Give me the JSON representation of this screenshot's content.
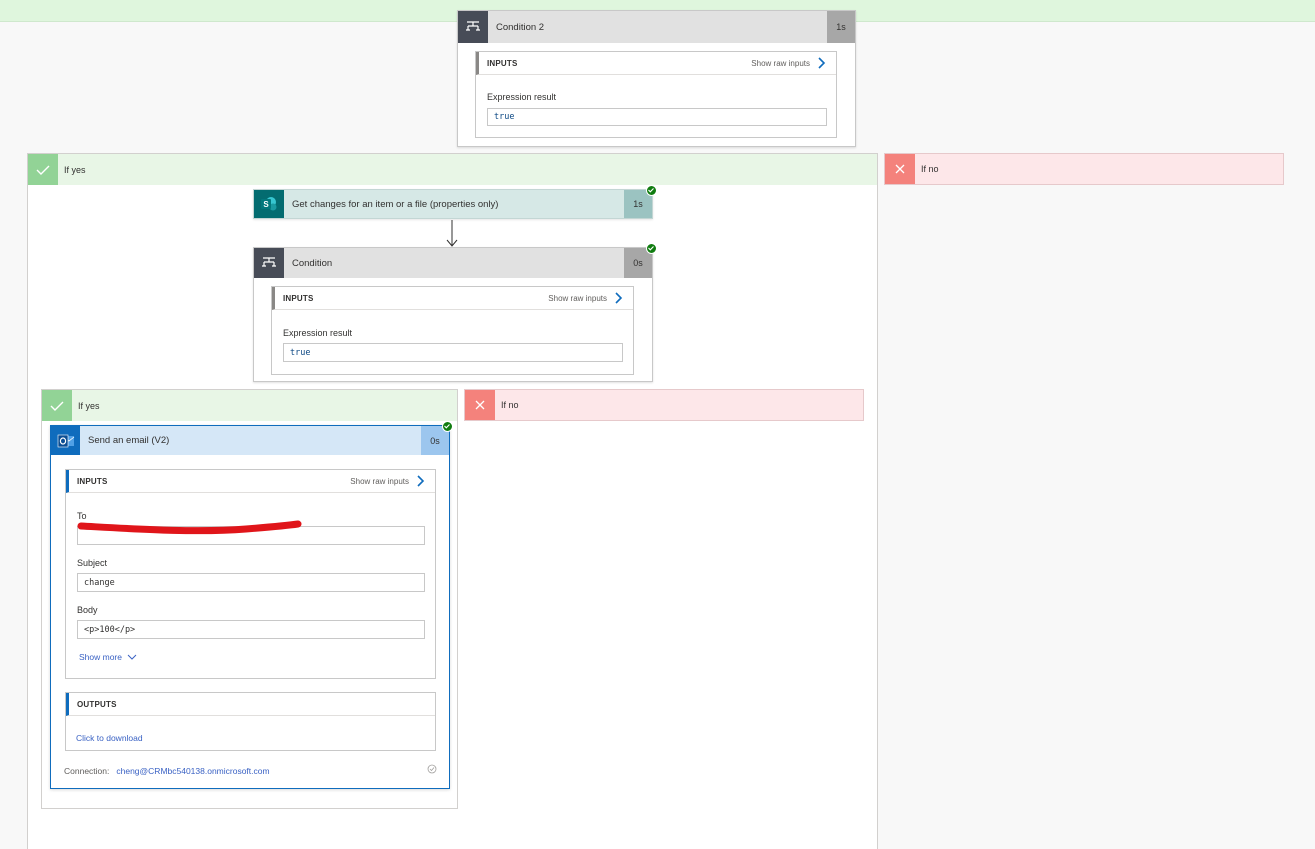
{
  "condition2": {
    "title": "Condition 2",
    "duration": "1s",
    "inputs_label": "INPUTS",
    "show_raw": "Show raw inputs",
    "expr_label": "Expression result",
    "expr_value": "true"
  },
  "branch_outer_yes": {
    "label": "If yes"
  },
  "branch_outer_no": {
    "label": "If no"
  },
  "get_changes": {
    "title": "Get changes for an item or a file (properties only)",
    "duration": "1s"
  },
  "condition": {
    "title": "Condition",
    "duration": "0s",
    "inputs_label": "INPUTS",
    "show_raw": "Show raw inputs",
    "expr_label": "Expression result",
    "expr_value": "true"
  },
  "branch_inner_yes": {
    "label": "If yes"
  },
  "branch_inner_no": {
    "label": "If no"
  },
  "send_email": {
    "title": "Send an email (V2)",
    "duration": "0s",
    "inputs_label": "INPUTS",
    "show_raw": "Show raw inputs",
    "to_label": "To",
    "subject_label": "Subject",
    "subject_value": "change",
    "body_label": "Body",
    "body_value": "<p>100</p>",
    "show_more": "Show more",
    "outputs_label": "OUTPUTS",
    "download": "Click to download",
    "connection_label": "Connection:",
    "connection_value": "cheng@CRMbc540138.onmicrosoft.com"
  },
  "colors": {
    "success": "#107c10",
    "yes_bg": "#e8f6e6",
    "yes_icon": "#92d396",
    "no_bg": "#fde7e9",
    "no_icon": "#f4827c",
    "sharepoint": "#036c70",
    "outlook": "#0f6cbd",
    "condition": "#474c57"
  }
}
